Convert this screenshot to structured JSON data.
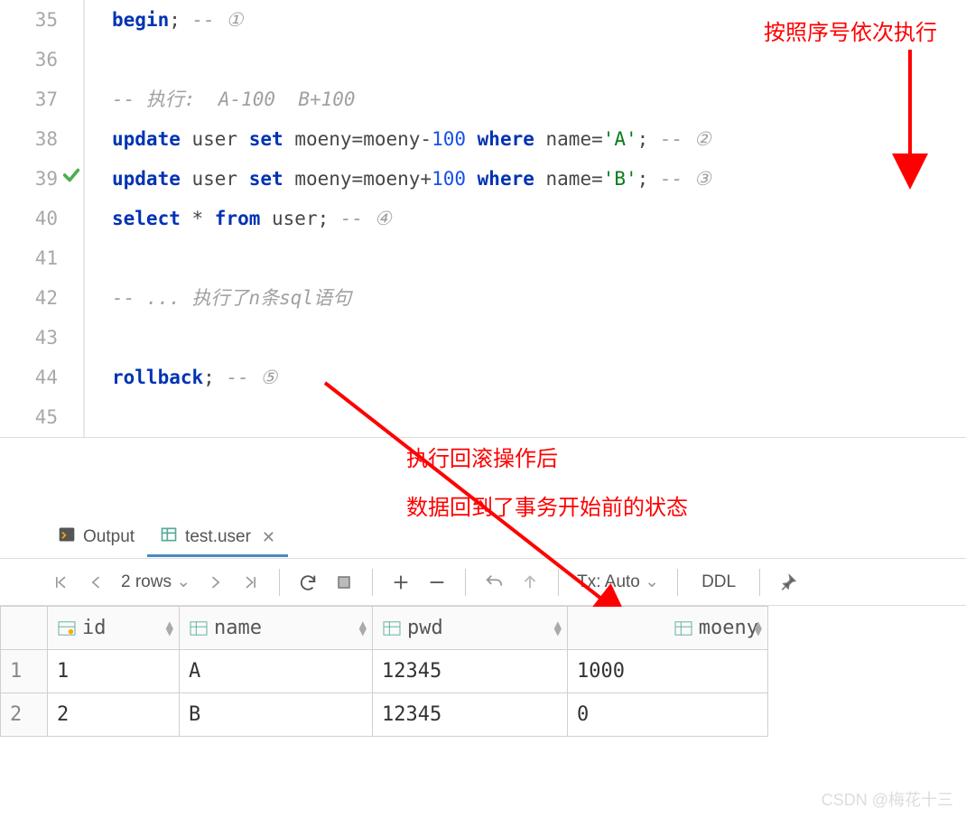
{
  "editor": {
    "lines": [
      {
        "n": "35"
      },
      {
        "n": "36"
      },
      {
        "n": "37"
      },
      {
        "n": "38"
      },
      {
        "n": "39",
        "check": true
      },
      {
        "n": "40"
      },
      {
        "n": "41"
      },
      {
        "n": "42"
      },
      {
        "n": "43"
      },
      {
        "n": "44"
      },
      {
        "n": "45"
      }
    ],
    "code": {
      "begin": "begin",
      "semi1": ";",
      "c1": " -- ①",
      "c_exec": "-- 执行:  A-100  B+100",
      "update": "update",
      "user1": " user ",
      "set": "set",
      "sp": " ",
      "moeny_eq": "moeny",
      "eq": "=",
      "moeny2": "moeny",
      "minus": "-",
      "n100": "100",
      "plus": "+",
      "where": " where ",
      "where_kw": "where",
      "name_eq": " name=",
      "strA": "'A'",
      "strB": "'B'",
      "semi": ";",
      "c2": " -- ②",
      "c3": " -- ③",
      "select": "select",
      "star": " * ",
      "from": "from",
      "user2": " user",
      "c4": " -- ④",
      "c_n": "-- ... 执行了n条sql语句",
      "rollback": "rollback",
      "c5": " -- ⑤"
    },
    "annot_top": "按照序号依次执行",
    "annot_mid1": "执行回滚操作后",
    "annot_mid2": "数据回到了事务开始前的状态"
  },
  "tabs": {
    "output": "Output",
    "testuser": "test.user"
  },
  "toolbar": {
    "rows": "2 rows",
    "tx": "Tx: Auto",
    "ddl": "DDL"
  },
  "table": {
    "headers": {
      "id": "id",
      "name": "name",
      "pwd": "pwd",
      "moeny": "moeny"
    },
    "rows": [
      {
        "n": "1",
        "id": "1",
        "name": "A",
        "pwd": "12345",
        "moeny": "1000"
      },
      {
        "n": "2",
        "id": "2",
        "name": "B",
        "pwd": "12345",
        "moeny": "0"
      }
    ]
  },
  "watermark": "CSDN @梅花十三"
}
